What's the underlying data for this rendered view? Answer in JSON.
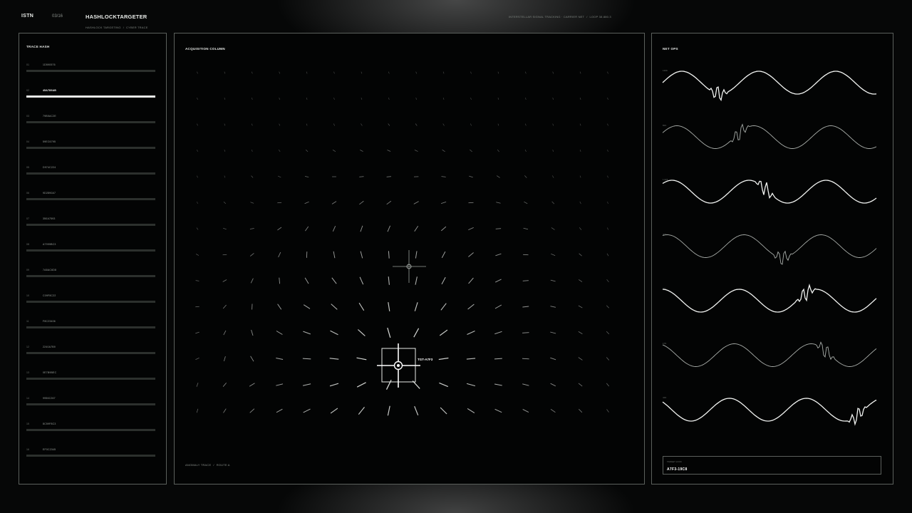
{
  "header": {
    "brand": "ISTN",
    "page_count": "03/16",
    "title": "HASHLOCKTARGETER",
    "breadcrumb": [
      "HASHLOCK TARGETING",
      "CYBER TRACE"
    ],
    "status": [
      "INTERSTELLAR SIGNAL TRACKING · CARRIER NET",
      "LOOP 38.880.3"
    ]
  },
  "left_panel": {
    "title": "TRACE HASH",
    "active_index": 1,
    "items": [
      {
        "idx": "01",
        "code": "1D590576"
      },
      {
        "idx": "02",
        "code": "45A789AB"
      },
      {
        "idx": "03",
        "code": "79B5AC2E"
      },
      {
        "idx": "04",
        "code": "59EC6795"
      },
      {
        "idx": "05",
        "code": "D974C224"
      },
      {
        "idx": "06",
        "code": "9D2890A7"
      },
      {
        "idx": "07",
        "code": "350A7593"
      },
      {
        "idx": "08",
        "code": "A7999BC3"
      },
      {
        "idx": "09",
        "code": "7A8AC6D8"
      },
      {
        "idx": "10",
        "code": "C09F8C22"
      },
      {
        "idx": "11",
        "code": "F8C23406"
      },
      {
        "idx": "12",
        "code": "2240A7B9"
      },
      {
        "idx": "13",
        "code": "0E7B9BEC"
      },
      {
        "idx": "14",
        "code": "9956C267"
      },
      {
        "idx": "15",
        "code": "8C59F8C3"
      },
      {
        "idx": "16",
        "code": "EF0C2345"
      }
    ]
  },
  "center_panel": {
    "title": "ACQUISITION COLUMN",
    "target_label": "TGT-A7F3",
    "footer": [
      "ANOMALY TRACE",
      "ROUTE A"
    ]
  },
  "right_panel": {
    "title": "NET OPS",
    "waves": [
      {
        "label": "1309",
        "disturb": 0.26,
        "bright": 1.0
      },
      {
        "label": "823",
        "disturb": 0.36,
        "bright": 0.7
      },
      {
        "label": "1,026",
        "disturb": 0.48,
        "bright": 1.0
      },
      {
        "label": "408",
        "disturb": 0.56,
        "bright": 0.7
      },
      {
        "label": "711",
        "disturb": 0.67,
        "bright": 1.0
      },
      {
        "label": "179",
        "disturb": 0.76,
        "bright": 0.7
      },
      {
        "label": "419",
        "disturb": 0.91,
        "bright": 1.0
      }
    ],
    "target": {
      "label": "TARGET LOCK",
      "value": "A7F3-19C8"
    }
  },
  "colors": {
    "background": "#060707",
    "panel_border": "#5b605c",
    "accent": "#ffffff",
    "bar_inactive": "#2c302d"
  }
}
